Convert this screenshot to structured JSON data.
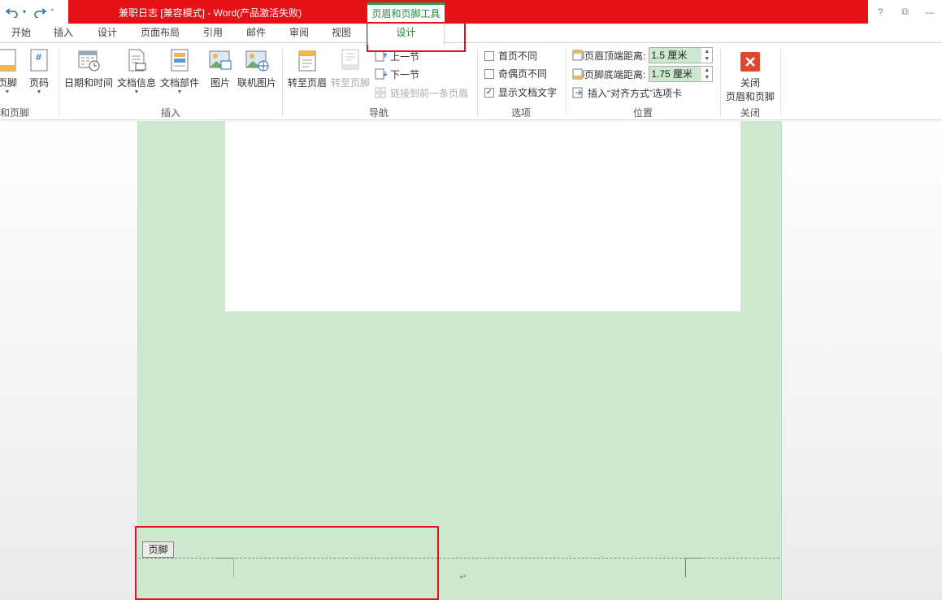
{
  "qat": {
    "undo_icon": "undo-icon",
    "redo_icon": "redo-icon",
    "customize_icon": "customize-icon"
  },
  "window": {
    "title": "兼职日志 [兼容模式] -  Word(产品激活失败)",
    "context_tab_title": "页眉和页脚工具",
    "controls": {
      "help": "?",
      "restore": "⧉",
      "minimize": "—"
    }
  },
  "tabs": [
    {
      "label": "开始"
    },
    {
      "label": "插入"
    },
    {
      "label": "设计"
    },
    {
      "label": "页面布局"
    },
    {
      "label": "引用"
    },
    {
      "label": "邮件"
    },
    {
      "label": "审阅"
    },
    {
      "label": "视图"
    },
    {
      "label": "设计",
      "active": true
    }
  ],
  "ribbon": {
    "header_footer_group": {
      "label": "和页脚",
      "footer_btn": "页脚",
      "page_num_btn": "页码"
    },
    "insert_group": {
      "label": "插入",
      "date_time": "日期和时间",
      "doc_info": "文档信息",
      "doc_parts": "文档部件",
      "picture": "图片",
      "online_picture": "联机图片"
    },
    "nav_group": {
      "label": "导航",
      "goto_header": "转至页眉",
      "goto_footer": "转至页脚",
      "prev_section": "上一节",
      "next_section": "下一节",
      "link_prev": "链接到前一条页眉"
    },
    "options_group": {
      "label": "选项",
      "first_page": "首页不同",
      "odd_even": "奇偶页不同",
      "show_doc_text": "显示文档文字",
      "show_doc_text_checked": "✓"
    },
    "position_group": {
      "label": "位置",
      "header_top": "页眉顶端距离:",
      "header_top_value": "1.5 厘米",
      "footer_bottom": "页脚底端距离:",
      "footer_bottom_value": "1.75 厘米",
      "insert_align_tab": "插入“对齐方式”选项卡"
    },
    "close_group": {
      "label": "关闭",
      "close_btn_line1": "关闭",
      "close_btn_line2": "页眉和页脚"
    }
  },
  "document": {
    "footer_tag": "页脚",
    "para_mark": "↵"
  },
  "colors": {
    "title_bar": "#e61017",
    "context_green": "#1f8a3f",
    "page_bg": "#cce8cf",
    "highlight": "#e61017"
  }
}
